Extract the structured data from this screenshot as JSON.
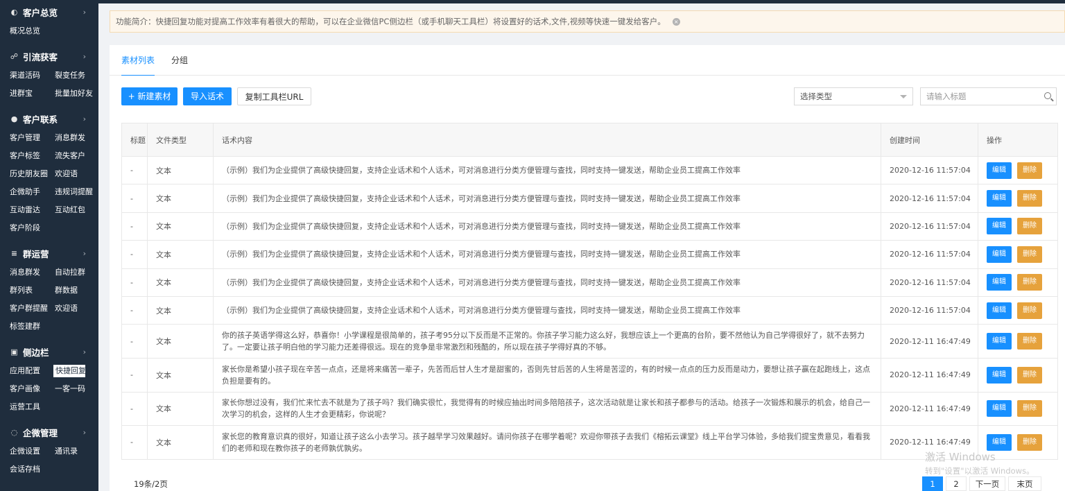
{
  "sidebar": {
    "sections": [
      {
        "title": "客户总览",
        "icon": "chart-pie-icon",
        "glyph": "◐",
        "items": [
          "概况总览"
        ]
      },
      {
        "title": "引流获客",
        "icon": "nodes-icon",
        "glyph": "☍",
        "items": [
          "渠道活码",
          "裂变任务",
          "进群宝",
          "批量加好友"
        ]
      },
      {
        "title": "客户联系",
        "icon": "user-icon",
        "glyph": "●",
        "items": [
          "客户管理",
          "消息群发",
          "客户标签",
          "流失客户",
          "历史朋友圈",
          "欢迎语",
          "企微助手",
          "违规词提醒",
          "互动雷达",
          "互动红包",
          "客户阶段"
        ]
      },
      {
        "title": "群运营",
        "icon": "list-icon",
        "glyph": "≡",
        "items": [
          "消息群发",
          "自动拉群",
          "群列表",
          "群数据",
          "客户群提醒",
          "欢迎语",
          "标签建群"
        ]
      },
      {
        "title": "侧边栏",
        "icon": "grid-icon",
        "glyph": "▣",
        "items": [
          "应用配置",
          "快捷回复",
          "客户画像",
          "一客一码",
          "运营工具"
        ]
      },
      {
        "title": "企微管理",
        "icon": "chat-icon",
        "glyph": "◌",
        "items": [
          "企微设置",
          "通讯录",
          "会话存档"
        ]
      }
    ],
    "active_item": "快捷回复"
  },
  "notice": {
    "text": "功能简介：快捷回复功能对提高工作效率有着很大的帮助，可以在企业微信PC侧边栏（或手机聊天工具栏）将设置好的话术,文件,视频等快速一键发给客户。",
    "close_glyph": "×"
  },
  "tabs": [
    {
      "label": "素材列表",
      "active": true
    },
    {
      "label": "分组",
      "active": false
    }
  ],
  "toolbar": {
    "new_label": "+ 新建素材",
    "import_label": "导入话术",
    "copy_url_label": "复制工具栏URL",
    "type_select_placeholder": "选择类型",
    "search_placeholder": "请输入标题"
  },
  "table": {
    "headers": [
      "标题",
      "文件类型",
      "话术内容",
      "创建时间",
      "操作"
    ],
    "rows": [
      {
        "title": "-",
        "type": "文本",
        "content": "（示例）我们为企业提供了高级快捷回复，支持企业话术和个人话术，可对消息进行分类方便管理与查找，同时支持一键发送，帮助企业员工提高工作效率",
        "time": "2020-12-16 11:57:04"
      },
      {
        "title": "-",
        "type": "文本",
        "content": "（示例）我们为企业提供了高级快捷回复，支持企业话术和个人话术，可对消息进行分类方便管理与查找，同时支持一键发送，帮助企业员工提高工作效率",
        "time": "2020-12-16 11:57:04"
      },
      {
        "title": "-",
        "type": "文本",
        "content": "（示例）我们为企业提供了高级快捷回复，支持企业话术和个人话术，可对消息进行分类方便管理与查找，同时支持一键发送，帮助企业员工提高工作效率",
        "time": "2020-12-16 11:57:04"
      },
      {
        "title": "-",
        "type": "文本",
        "content": "（示例）我们为企业提供了高级快捷回复，支持企业话术和个人话术，可对消息进行分类方便管理与查找，同时支持一键发送，帮助企业员工提高工作效率",
        "time": "2020-12-16 11:57:04"
      },
      {
        "title": "-",
        "type": "文本",
        "content": "（示例）我们为企业提供了高级快捷回复，支持企业话术和个人话术，可对消息进行分类方便管理与查找，同时支持一键发送，帮助企业员工提高工作效率",
        "time": "2020-12-16 11:57:04"
      },
      {
        "title": "-",
        "type": "文本",
        "content": "（示例）我们为企业提供了高级快捷回复，支持企业话术和个人话术，可对消息进行分类方便管理与查找，同时支持一键发送，帮助企业员工提高工作效率",
        "time": "2020-12-16 11:57:04"
      },
      {
        "title": "-",
        "type": "文本",
        "content": "你的孩子英语学得这么好，恭喜你！小学课程是很简单的，孩子考95分以下反而是不正常的。你孩子学习能力这么好，我想应该上一个更高的台阶，要不然他认为自己学得很好了，就不去努力了。一定要让孩子明白他的学习能力还差得很远。现在的竞争是非常激烈和残酷的，所以现在孩子学得好真的不够。",
        "time": "2020-12-11 16:47:49"
      },
      {
        "title": "-",
        "type": "文本",
        "content": "家长你是希望小孩子现在辛苦一点点，还是将来痛苦一辈子，先苦而后甘人生才是甜蜜的，否则先甘后苦的人生将是苦涩的，有的时候一点点的压力反而是动力，要想让孩子赢在起跑线上，这点负担是要有的。",
        "time": "2020-12-11 16:47:49"
      },
      {
        "title": "-",
        "type": "文本",
        "content": "家长你想过没有，我们忙来忙去不就是为了孩子吗？我们确实很忙，我觉得有的时候应抽出时间多陪陪孩子，这次活动就是让家长和孩子都参与的活动。给孩子一次锻炼和展示的机会，给自己一次学习的机会，这样的人生才会更精彩，你说呢？",
        "time": "2020-12-11 16:47:49"
      },
      {
        "title": "-",
        "type": "文本",
        "content": "家长您的教育意识真的很好，知道让孩子这么小去学习。孩子越早学习效果越好。请问你孩子在哪学着呢？欢迎你带孩子去我们《榕拓云课堂》线上平台学习体验，多给我们提宝贵意见，看看我们的老师和现在教你孩子的老师孰优孰劣。",
        "time": "2020-12-11 16:47:49"
      }
    ],
    "edit_label": "编辑",
    "delete_label": "删除"
  },
  "footer": {
    "count_text": "19条/2页"
  },
  "pagination": {
    "pages": [
      "1",
      "2"
    ],
    "current": "1",
    "next_label": "下一页",
    "last_label": "末页"
  },
  "watermark": {
    "line1": "激活 Windows",
    "line2": "转到\"设置\"以激活 Windows。"
  },
  "colors": {
    "sidebar_bg": "#1f2d3d",
    "primary": "#1890ff",
    "warning": "#e6a23c",
    "notice_bg": "#fdf6ec"
  }
}
